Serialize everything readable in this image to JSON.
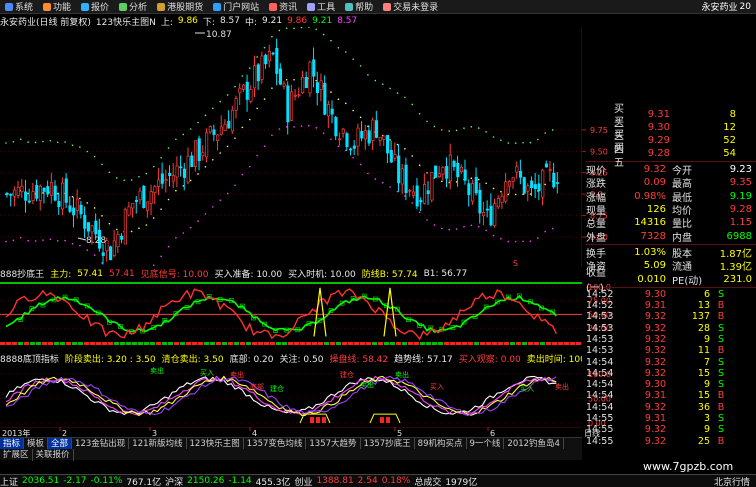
{
  "menu": {
    "items": [
      {
        "label": "系统",
        "icon": "system-icon",
        "color": "#4a8cff"
      },
      {
        "label": "功能",
        "icon": "function-icon",
        "color": "#ff8c30"
      },
      {
        "label": "报价",
        "icon": "quote-icon",
        "color": "#30b0ff"
      },
      {
        "label": "分析",
        "icon": "analysis-icon",
        "color": "#60d060"
      },
      {
        "label": "港股期货",
        "icon": "hk-futures-icon",
        "color": "#d0a030"
      },
      {
        "label": "门户网站",
        "icon": "portal-icon",
        "color": "#30a0ff"
      },
      {
        "label": "资讯",
        "icon": "news-icon",
        "color": "#ff6060"
      },
      {
        "label": "工具",
        "icon": "tools-icon",
        "color": "#a0a0ff"
      },
      {
        "label": "帮助",
        "icon": "help-icon",
        "color": "#50c0c0"
      },
      {
        "label": "交易未登录",
        "icon": "trade-icon",
        "color": "#ff8080"
      }
    ],
    "stock_name": "永安药业",
    "stock_suffix": "20"
  },
  "title_bar": {
    "stock": "永安药业(日线 前复权)",
    "indicator": "123快乐主图N",
    "up_label": "上:",
    "up_value": "9.86",
    "down_label": "下:",
    "down_value": "8.57",
    "mid_label": "中:",
    "mid_value": "9.21",
    "v1": "9.86",
    "v2": "9.21",
    "v3": "8.57"
  },
  "main_chart": {
    "high_label": "10.87",
    "low_label": "8.28",
    "y_ticks": [
      "9.75",
      "9.50",
      "9.25",
      "9.0",
      "8.75",
      "8.50"
    ],
    "marker_s": "S"
  },
  "ind1": {
    "name": "888抄底王",
    "main_label": "主力:",
    "main_value": "57.41",
    "value2": "57.41",
    "signal": "见底信号: 10.00",
    "prepare": "买入准备: 10.00",
    "buy_time": "买入时机: 10.00",
    "defense": "防线B: 57.74",
    "b1": "B1: 56.77",
    "y_ticks": [
      "100.0",
      "75.00",
      "50.00",
      "25.00"
    ]
  },
  "ind2": {
    "name": "8888底顶指标",
    "phase": "阶段卖出: 3.20 : 3.50",
    "clear": "清仓卖出: 3.50",
    "bottom": "底部: 0.20",
    "focus": "关注: 0.50",
    "operate": "操盘线: 58.42",
    "trend": "趋势线: 57.17",
    "buy_watch": "买入观察: 0.00",
    "sell_time": "卖出时间: 100.00",
    "y_ticks": [
      "100.0",
      "50.00",
      "0.00"
    ],
    "annotations": [
      "买入",
      "卖出",
      "卖出",
      "底部",
      "建仓",
      "建仓",
      "卖出",
      "买入",
      "买入",
      "卖出",
      "卖出"
    ]
  },
  "axis": {
    "year": "2013年",
    "months": [
      "2",
      "3",
      "4",
      "5",
      "6"
    ],
    "period": "日线"
  },
  "quotes": {
    "levels": [
      {
        "label": "买二",
        "price": "9.31",
        "vol": "8"
      },
      {
        "label": "买三",
        "price": "9.30",
        "vol": "12"
      },
      {
        "label": "买四",
        "price": "9.29",
        "vol": "52"
      },
      {
        "label": "买五",
        "price": "9.28",
        "vol": "54"
      }
    ],
    "stats": [
      {
        "l1": "现价",
        "v1": "9.32",
        "c1": "#ff3c3c",
        "l2": "今开",
        "v2": "9.23",
        "c2": "#ffffff"
      },
      {
        "l1": "涨跌",
        "v1": "0.09",
        "c1": "#ff3c3c",
        "l2": "最高",
        "v2": "9.35",
        "c2": "#ff3c3c"
      },
      {
        "l1": "涨幅",
        "v1": "0.98%",
        "c1": "#ff3c3c",
        "l2": "最低",
        "v2": "9.19",
        "c2": "#00ff00"
      },
      {
        "l1": "现量",
        "v1": "126",
        "c1": "#ffff00",
        "l2": "均价",
        "v2": "9.28",
        "c2": "#ff3c3c"
      },
      {
        "l1": "总量",
        "v1": "14316",
        "c1": "#ffff00",
        "l2": "量比",
        "v2": "1.15",
        "c2": "#ff3c3c"
      },
      {
        "l1": "外盘",
        "v1": "7328",
        "c1": "#ff3c3c",
        "l2": "内盘",
        "v2": "6988",
        "c2": "#00ff00"
      }
    ],
    "stats2": [
      {
        "l1": "换手",
        "v1": "1.03%",
        "c1": "#ffff00",
        "l2": "股本",
        "v2": "1.87亿",
        "c2": "#ffff00"
      },
      {
        "l1": "净资",
        "v1": "5.09",
        "c1": "#ffff00",
        "l2": "流通",
        "v2": "1.39亿",
        "c2": "#ffff00"
      },
      {
        "l1": "收益(一)",
        "v1": "0.010",
        "c1": "#ffff00",
        "l2": "PE(动)",
        "v2": "231.0",
        "c2": "#ffff00"
      }
    ],
    "ticks": [
      {
        "time": "14:52",
        "price": "9.30",
        "vol": "6",
        "bs": "S"
      },
      {
        "time": "14:52",
        "price": "9.31",
        "vol": "13",
        "bs": "B"
      },
      {
        "time": "14:53",
        "price": "9.32",
        "vol": "137",
        "bs": "B"
      },
      {
        "time": "14:53",
        "price": "9.32",
        "vol": "28",
        "bs": "S"
      },
      {
        "time": "14:53",
        "price": "9.32",
        "vol": "9",
        "bs": "S"
      },
      {
        "time": "14:53",
        "price": "9.32",
        "vol": "11",
        "bs": "B"
      },
      {
        "time": "14:54",
        "price": "9.32",
        "vol": "7",
        "bs": "S"
      },
      {
        "time": "14:54",
        "price": "9.32",
        "vol": "15",
        "bs": "S"
      },
      {
        "time": "14:54",
        "price": "9.30",
        "vol": "9",
        "bs": "S"
      },
      {
        "time": "14:54",
        "price": "9.31",
        "vol": "15",
        "bs": "B"
      },
      {
        "time": "14:54",
        "price": "9.32",
        "vol": "36",
        "bs": "B"
      },
      {
        "time": "14:55",
        "price": "9.31",
        "vol": "3",
        "bs": "S"
      },
      {
        "time": "14:55",
        "price": "9.32",
        "vol": "9",
        "bs": "S"
      },
      {
        "time": "14:55",
        "price": "9.32",
        "vol": "25",
        "bs": "B"
      }
    ]
  },
  "tabs": [
    {
      "label": "指标",
      "active": true
    },
    {
      "label": "模板",
      "active": false
    },
    {
      "label": "全部",
      "active": true
    },
    {
      "label": "123金钻出现",
      "active": false
    },
    {
      "label": "121新版均线",
      "active": false
    },
    {
      "label": "123快乐主图",
      "active": false
    },
    {
      "label": "1357变色均线",
      "active": false
    },
    {
      "label": "1357大趋势",
      "active": false
    },
    {
      "label": "1357抄底王",
      "active": false
    },
    {
      "label": "89机构买点",
      "active": false
    },
    {
      "label": "9一个线",
      "active": false
    },
    {
      "label": "2012钓鱼岛4",
      "active": false
    }
  ],
  "tabs2": [
    {
      "label": "扩展区"
    },
    {
      "label": "关联报价"
    }
  ],
  "status": {
    "sh_label": "上证",
    "sh_value": "2036.51",
    "sh_change": "-2.17",
    "sh_pct": "-0.11%",
    "sh_amount": "767.1亿",
    "sz_label": "沪深",
    "sz_value": "2150.26",
    "sz_change": "-1.14",
    "sz_amount": "455.3亿",
    "cy_label": "创业",
    "cy_value": "1388.81",
    "cy_change": "2.54",
    "cy_pct": "0.18%",
    "total_label": "总成交",
    "total_value": "1979亿",
    "broker": "北京行情"
  },
  "watermark": "www.7gpzb.com",
  "colors": {
    "up": "#ff3c3c",
    "down": "#00e0ff",
    "bg": "#000000",
    "grid": "#5a1010"
  }
}
